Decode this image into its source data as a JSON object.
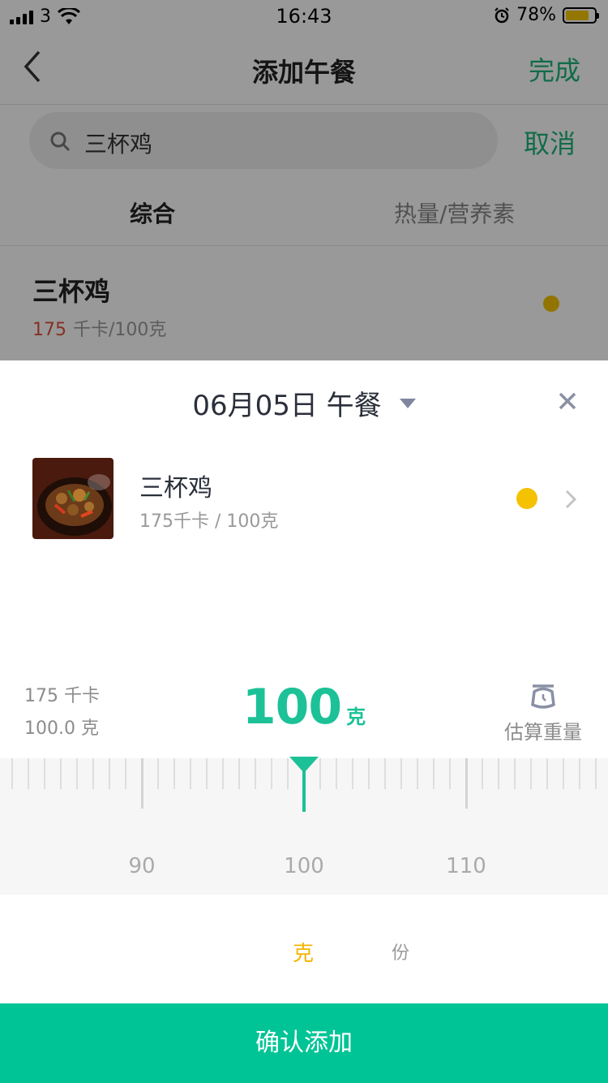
{
  "status_bar": {
    "carrier": "3",
    "time": "16:43",
    "battery_percent": "78%",
    "battery_level": 0.78
  },
  "nav": {
    "title": "添加午餐",
    "done": "完成"
  },
  "search": {
    "value": "三杯鸡",
    "cancel": "取消"
  },
  "tabs": [
    "综合",
    "热量/营养素"
  ],
  "result": {
    "name": "三杯鸡",
    "kcal": "175",
    "per": "千卡/100克",
    "dot_color": "#f4c200"
  },
  "sheet": {
    "title": "06月05日 午餐",
    "food": {
      "name": "三杯鸡",
      "sub": "175千卡 / 100克",
      "dot_color": "#f4c200"
    },
    "summary": {
      "kcal": "175 千卡",
      "grams": "100.0 克"
    },
    "weight": {
      "value": "100",
      "unit": "克"
    },
    "scale_label": "估算重量",
    "ruler": {
      "labels": [
        "90",
        "100",
        "110"
      ],
      "min": 81,
      "max": 118,
      "selected": 100
    },
    "units": {
      "gram": "克",
      "portion": "份"
    },
    "confirm": "确认添加"
  },
  "colors": {
    "accent": "#1cc197",
    "confirm": "#00c495",
    "highlight": "#f3b400"
  }
}
